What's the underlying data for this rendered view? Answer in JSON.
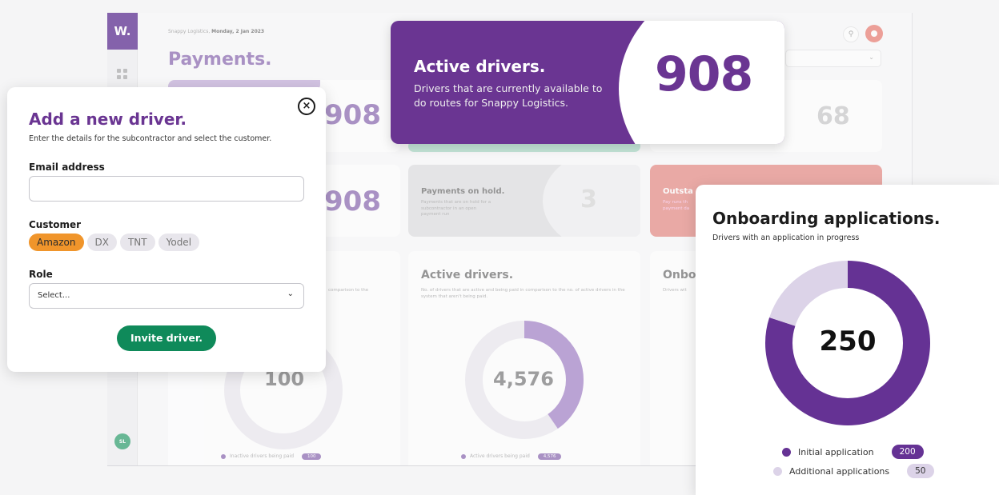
{
  "background": {
    "logo": "W.",
    "breadcrumb_company": "Snappy Logistics,",
    "breadcrumb_date": "Monday, 2 Jan 2023",
    "page_title": "Payments.",
    "avatar_initials": "SL",
    "card_values": {
      "top_left": "908",
      "top_right": "68",
      "mid_left": "908",
      "on_hold": "3"
    },
    "on_hold_card": {
      "title": "Payments on hold.",
      "desc": "Payments that are on hold for a subcontractor in an open payment run"
    },
    "outstanding_card": {
      "title": "Outsta",
      "desc": "Pay runs th payment da"
    },
    "left_chart": {
      "desc": "comparison to the",
      "value": "100",
      "legend": "Inactive drivers being paid",
      "legend_value": "100"
    },
    "mid_chart": {
      "title": "Active drivers.",
      "desc": "No. of drivers that are active and being paid in comparison to the no. of active drivers in the system that aren't being paid.",
      "value": "4,576",
      "legend": "Active drivers being paid",
      "legend_value": "4,576"
    },
    "right_chart": {
      "title": "Onbo",
      "desc": "Drivers wit"
    }
  },
  "modal": {
    "title": "Add a new driver.",
    "description": "Enter the details for the subcontractor and select the customer.",
    "close_glyph": "×",
    "email_label": "Email address",
    "email_value": "",
    "customer_label": "Customer",
    "customers": [
      "Amazon",
      "DX",
      "TNT",
      "Yodel"
    ],
    "selected_customer": "Amazon",
    "role_label": "Role",
    "role_value": "Select...",
    "submit_label": "Invite driver."
  },
  "active_drivers": {
    "title": "Active drivers.",
    "description": "Drivers that are currently available to do routes for Snappy Logistics.",
    "value": "908"
  },
  "onboarding": {
    "title": "Onboarding applications.",
    "description": "Drivers with an application in progress",
    "total": "250",
    "segments": [
      {
        "label": "Initial application",
        "value": 200,
        "value_text": "200",
        "color": "#653294"
      },
      {
        "label": "Additional applications",
        "value": 50,
        "value_text": "50",
        "color": "#dcd3e8"
      }
    ]
  },
  "colors": {
    "brand_purple": "#6a3592",
    "invite_green": "#0f8a5a",
    "chip_orange": "#f0952b",
    "outstanding_red": "#d9534f"
  }
}
